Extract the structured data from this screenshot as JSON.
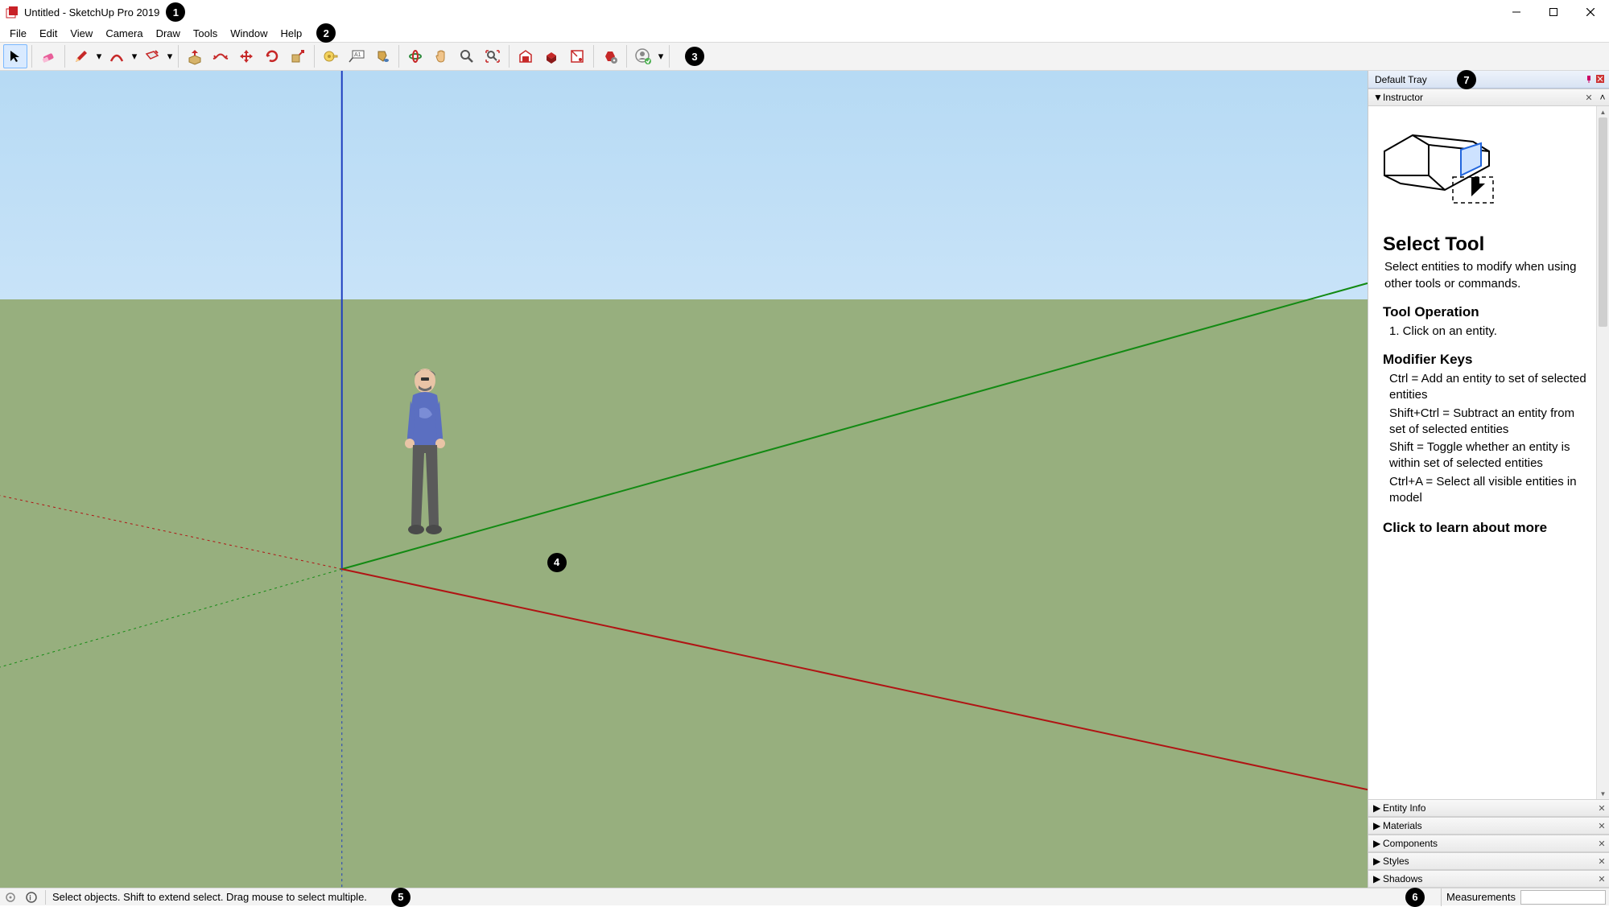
{
  "titlebar": {
    "title": "Untitled - SketchUp Pro 2019"
  },
  "annotations": [
    "1",
    "2",
    "3",
    "4",
    "5",
    "6",
    "7"
  ],
  "menubar": [
    "File",
    "Edit",
    "View",
    "Camera",
    "Draw",
    "Tools",
    "Window",
    "Help"
  ],
  "toolbar": {
    "groups": [
      [
        "select",
        "eraser",
        "pencil",
        "arc",
        "rectangle"
      ],
      [
        "pushpull",
        "offset",
        "move",
        "rotate",
        "scale"
      ],
      [
        "tape",
        "dimension",
        "paint"
      ],
      [
        "orbit",
        "pan",
        "zoom",
        "zoom-extents"
      ],
      [
        "warehouse",
        "components-wh",
        "layout",
        "advanced",
        "user"
      ]
    ]
  },
  "tray": {
    "title": "Default Tray",
    "panels": [
      {
        "name": "Instructor",
        "open": true
      },
      {
        "name": "Entity Info",
        "open": false
      },
      {
        "name": "Materials",
        "open": false
      },
      {
        "name": "Components",
        "open": false
      },
      {
        "name": "Styles",
        "open": false
      },
      {
        "name": "Shadows",
        "open": false
      }
    ],
    "instructor": {
      "title": "Select Tool",
      "subtitle": "Select entities to modify when using other tools or commands.",
      "op_heading": "Tool Operation",
      "op_step": "1. Click on an entity.",
      "mod_heading": "Modifier Keys",
      "mods": [
        "Ctrl = Add an entity to set of selected entities",
        "Shift+Ctrl = Subtract an entity from set of selected entities",
        "Shift = Toggle whether an entity is within set of selected entities",
        "Ctrl+A = Select all visible entities in model"
      ],
      "learn_more": "Click to learn about more"
    }
  },
  "statusbar": {
    "hint": "Select objects. Shift to extend select. Drag mouse to select multiple.",
    "measurements_label": "Measurements",
    "measurements_value": ""
  }
}
